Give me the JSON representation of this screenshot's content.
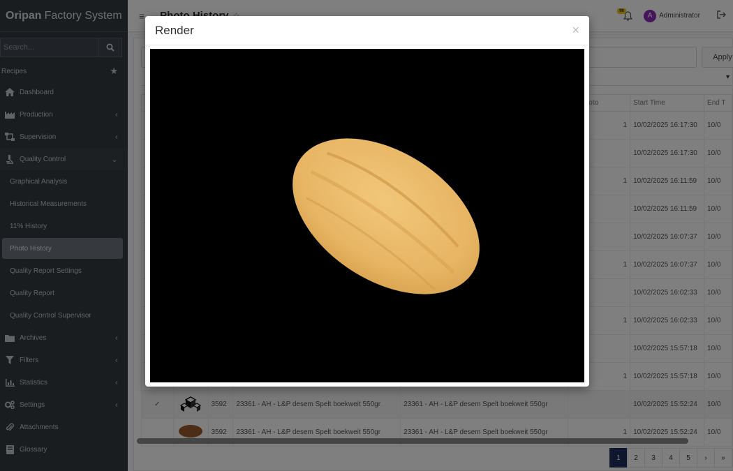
{
  "brand": {
    "bold": "Oripan",
    "rest": "Factory System"
  },
  "search": {
    "placeholder": "Search..."
  },
  "sidebar": {
    "recipes": "Recipes",
    "items": [
      {
        "label": "Dashboard",
        "icon": "home-icon"
      },
      {
        "label": "Production",
        "icon": "factory-icon"
      },
      {
        "label": "Supervision",
        "icon": "sitemap-icon"
      },
      {
        "label": "Quality Control",
        "icon": "microscope-icon"
      }
    ],
    "sub_items": [
      "Graphical Analysis",
      "Historical Measurements",
      "11% History",
      "Photo History",
      "Quality Report Settings",
      "Quality Report",
      "Quality Control Supervisor"
    ],
    "lower_items": [
      {
        "label": "Archives",
        "icon": "folder-icon"
      },
      {
        "label": "Filters",
        "icon": "filter-icon"
      },
      {
        "label": "Statistics",
        "icon": "bar-chart-icon"
      },
      {
        "label": "Settings",
        "icon": "gears-icon"
      },
      {
        "label": "Attachments",
        "icon": "paperclip-icon"
      },
      {
        "label": "Glossary",
        "icon": "book-icon"
      }
    ]
  },
  "header": {
    "title": "Photo History",
    "notification_count": "98",
    "user": "Administrator",
    "avatar_letter": "A"
  },
  "toolbar": {
    "apply_label": "Apply"
  },
  "table": {
    "columns": {
      "ex_photo": "ex Photo",
      "start_time": "Start Time",
      "end_time": "End T"
    },
    "rows": [
      {
        "ex": "1",
        "start": "10/02/2025 16:17:30",
        "end": "10/0"
      },
      {
        "ex": "",
        "start": "10/02/2025 16:17:30",
        "end": "10/0"
      },
      {
        "ex": "1",
        "start": "10/02/2025 16:11:59",
        "end": "10/0"
      },
      {
        "ex": "",
        "start": "10/02/2025 16:11:59",
        "end": "10/0"
      },
      {
        "ex": "",
        "start": "10/02/2025 16:07:37",
        "end": "10/0"
      },
      {
        "ex": "1",
        "start": "10/02/2025 16:07:37",
        "end": "10/0"
      },
      {
        "ex": "",
        "start": "10/02/2025 16:02:33",
        "end": "10/0"
      },
      {
        "ex": "1",
        "start": "10/02/2025 16:02:33",
        "end": "10/0"
      },
      {
        "ex": "",
        "start": "10/02/2025 15:57:18",
        "end": "10/0"
      },
      {
        "ex": "1",
        "start": "10/02/2025 15:57:18",
        "end": "10/0"
      },
      {
        "id": "3592",
        "product": "23361 - AH - L&P desem Spelt boekweit 550gr",
        "product2": "23361 - AH - L&P desem Spelt boekweit 550gr",
        "ex": "",
        "start": "10/02/2025 15:52:24",
        "end": "10/0"
      },
      {
        "id": "3592",
        "product": "23361 - AH - L&P desem Spelt boekweit 550gr",
        "product2": "23361 - AH - L&P desem Spelt boekweit 550gr",
        "ex": "1",
        "start": "10/02/2025 15:52:24",
        "end": "10/0"
      }
    ]
  },
  "pagination": {
    "pages": [
      "1",
      "2",
      "3",
      "4",
      "5"
    ],
    "next": "›",
    "last": "»",
    "active": "1"
  },
  "modal": {
    "title": "Render",
    "close": "×"
  },
  "colors": {
    "sidebar": "#343a40",
    "accent": "#1f2f5e",
    "avatar": "#8e2bb6",
    "badge": "#f0c419",
    "bread": "#e8b866"
  }
}
